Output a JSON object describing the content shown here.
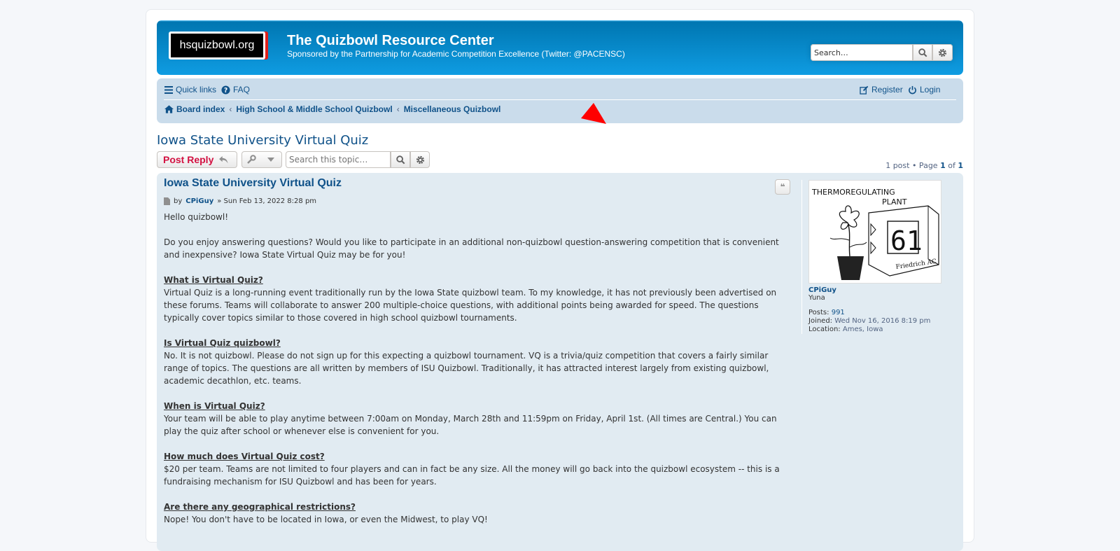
{
  "header": {
    "logo_text": "hsquizbowl.org",
    "site_title": "The Quizbowl Resource Center",
    "site_description": "Sponsored by the Partnership for Academic Competition Excellence (Twitter: @PACENSC)",
    "search_placeholder": "Search…",
    "search_icon": "search-icon",
    "advanced_icon": "gear-icon"
  },
  "navbar": {
    "quick_links": "Quick links",
    "faq": "FAQ",
    "register": "Register",
    "login": "Login",
    "breadcrumbs": [
      "Board index",
      "High School & Middle School Quizbowl",
      "Miscellaneous Quizbowl"
    ]
  },
  "topic": {
    "title": "Iowa State University Virtual Quiz",
    "post_reply": "Post Reply",
    "search_placeholder": "Search this topic…",
    "pagination": {
      "posts": "1 post • Page",
      "page": "1",
      "of": "of",
      "total": "1"
    }
  },
  "post": {
    "subject": "Iowa State University Virtual Quiz",
    "by": "by",
    "author": "CPiGuy",
    "date": "» Sun Feb 13, 2022 8:28 pm",
    "greeting": "Hello quizbowl!",
    "intro": "Do you enjoy answering questions? Would you like to participate in an additional non-quizbowl question-answering competition that is convenient and inexpensive? Iowa State Virtual Quiz may be for you!",
    "sections": [
      {
        "q": "What is Virtual Quiz?",
        "a": "Virtual Quiz is a long-running event traditionally run by the Iowa State quizbowl team. To my knowledge, it has not previously been advertised on these forums. Teams will collaborate to answer 200 multiple-choice questions, with additional points being awarded for speed. The questions typically cover topics similar to those covered in high school quizbowl tournaments."
      },
      {
        "q": "Is Virtual Quiz quizbowl?",
        "a": "No. It is not quizbowl. Please do not sign up for this expecting a quizbowl tournament. VQ is a trivia/quiz competition that covers a fairly similar range of topics. The questions are all written by members of ISU Quizbowl. Traditionally, it has attracted interest largely from existing quizbowl, academic decathlon, etc. teams."
      },
      {
        "q": "When is Virtual Quiz?",
        "a": "Your team will be able to play anytime between 7:00am on Monday, March 28th and 11:59pm on Friday, April 1st. (All times are Central.) You can play the quiz after school or whenever else is convenient for you."
      },
      {
        "q": "How much does Virtual Quiz cost?",
        "a": "$20 per team. Teams are not limited to four players and can in fact be any size. All the money will go back into the quizbowl ecosystem -- this is a fundraising mechanism for ISU Quizbowl and has been for years."
      },
      {
        "q": "Are there any geographical restrictions?",
        "a": "Nope! You don't have to be located in Iowa, or even the Midwest, to play VQ!"
      }
    ]
  },
  "profile": {
    "avatar_text_1": "THERMOREGULATING",
    "avatar_text_2": "PLANT",
    "avatar_text_3": "Friedrich AC",
    "avatar_digits": "61",
    "username": "CPiGuy",
    "rank": "Yuna",
    "posts_label": "Posts:",
    "posts": "991",
    "joined_label": "Joined:",
    "joined": "Wed Nov 16, 2016 8:19 pm",
    "location_label": "Location:",
    "location": "Ames, Iowa"
  },
  "colors": {
    "header_blue": "#12a3eb",
    "link": "#105289",
    "post_bg": "#e1ebf2",
    "nav_bg": "#cadceb",
    "reply_red": "#d31141",
    "pointer": "#ff0000"
  }
}
